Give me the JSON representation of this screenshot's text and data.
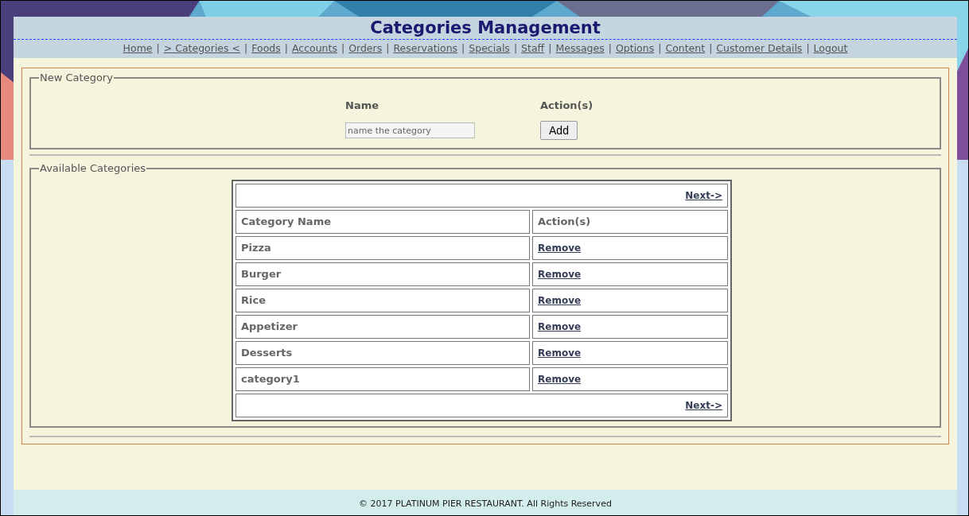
{
  "header": {
    "title": "Categories Management",
    "nav_separator": "|",
    "nav": [
      "Home",
      "> Categories <",
      "Foods",
      "Accounts",
      "Orders",
      "Reservations",
      "Specials",
      "Staff",
      "Messages",
      "Options",
      "Content",
      "Customer Details",
      "Logout"
    ]
  },
  "new_category": {
    "legend": "New Category",
    "name_label": "Name",
    "action_label": "Action(s)",
    "name_field": {
      "placeholder": "name the category"
    },
    "add_button": "Add"
  },
  "available_categories": {
    "legend": "Available Categories",
    "top_pager": "Next->",
    "columns": [
      "Category Name",
      "Action(s)"
    ],
    "rows": [
      {
        "name": "Pizza",
        "action": "Remove"
      },
      {
        "name": "Burger",
        "action": "Remove"
      },
      {
        "name": "Rice",
        "action": "Remove"
      },
      {
        "name": "Appetizer",
        "action": "Remove"
      },
      {
        "name": "Desserts",
        "action": "Remove"
      },
      {
        "name": "category1",
        "action": "Remove"
      }
    ],
    "bottom_pager": "Next->"
  },
  "footer": "© 2017 PLATINUM PIER RESTAURANT. All Rights Reserved"
}
